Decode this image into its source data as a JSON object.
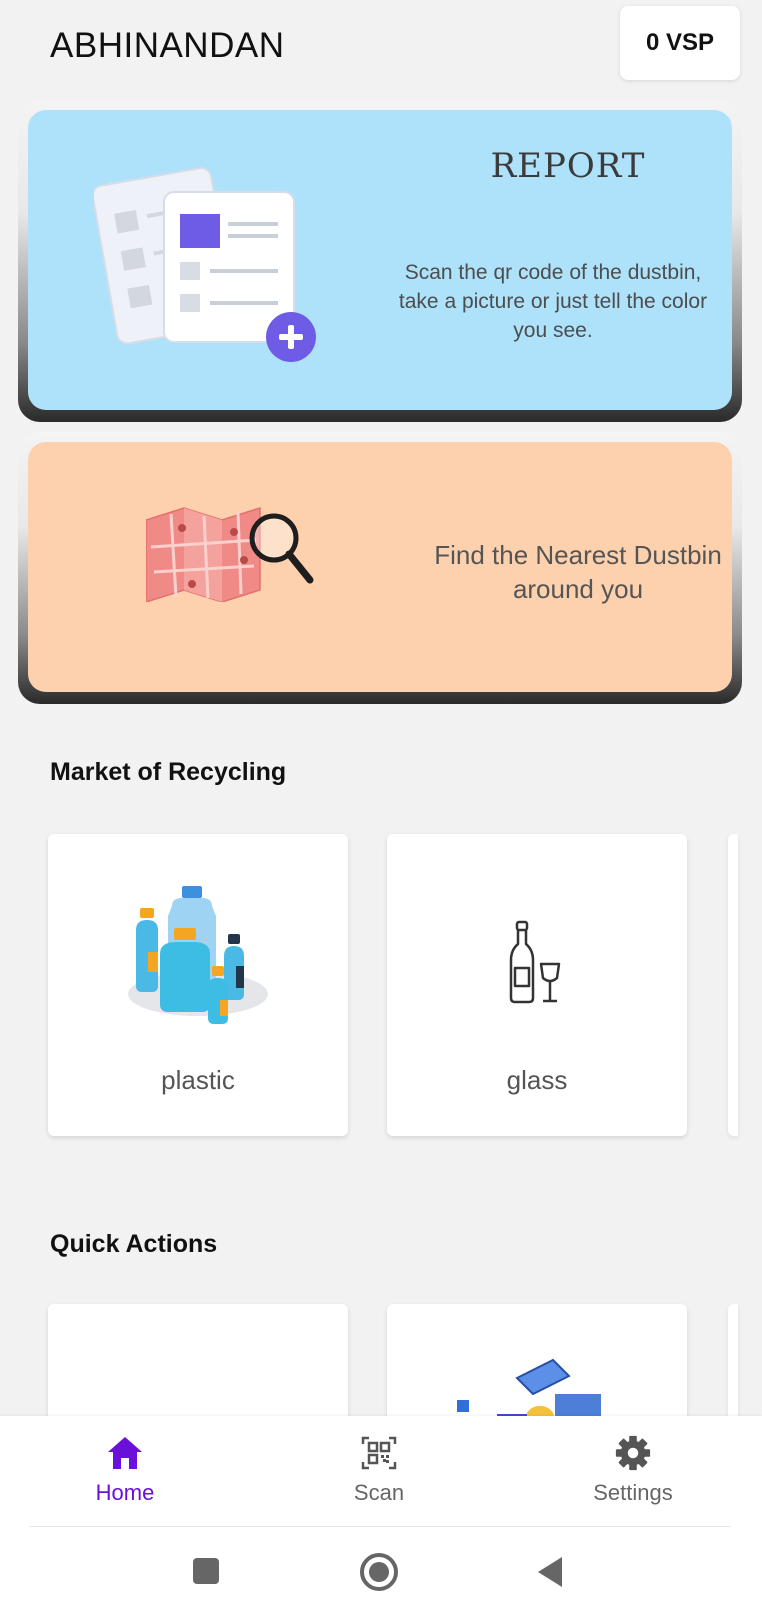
{
  "header": {
    "username": "ABHINANDAN",
    "points": "0 VSP"
  },
  "report_card": {
    "title": "REPORT",
    "description": "Scan the qr code of the dustbin, take a picture or just tell the color you see."
  },
  "dustbin_card": {
    "description": "Find the Nearest Dustbin around you"
  },
  "market": {
    "title": "Market of Recycling",
    "items": [
      {
        "label": "plastic",
        "icon": "plastic-bottles-icon"
      },
      {
        "label": "glass",
        "icon": "glass-bottle-icon"
      }
    ]
  },
  "quick_actions": {
    "title": "Quick Actions"
  },
  "bottom_nav": {
    "items": [
      {
        "label": "Home",
        "icon": "home-icon",
        "active": true
      },
      {
        "label": "Scan",
        "icon": "qr-scan-icon",
        "active": false
      },
      {
        "label": "Settings",
        "icon": "gear-icon",
        "active": false
      }
    ]
  },
  "colors": {
    "accent": "#6a10d9",
    "report_bg": "#ade2fa",
    "dustbin_bg": "#fed1ae",
    "app_bg": "#f2f2f2"
  }
}
